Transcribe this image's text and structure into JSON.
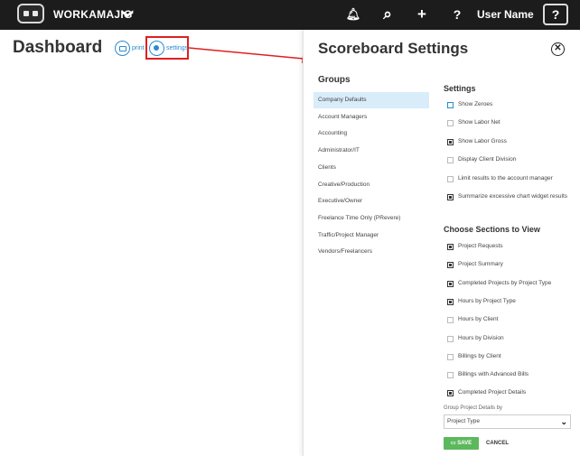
{
  "topbar": {
    "brand": "WORKAMAJIG",
    "brand_chevron": "❯",
    "icons": [
      "bell-icon",
      "search-icon",
      "plus-icon",
      "help-icon"
    ],
    "icon_glyphs": {
      "bell": "🔔︎",
      "search": "⌕",
      "plus": "+",
      "help": "?"
    },
    "username": "User Name",
    "help_box": "?"
  },
  "page": {
    "title": "Dashboard",
    "print_label": "print",
    "settings_label": "settings"
  },
  "panel": {
    "title": "Scoreboard Settings",
    "close_glyph": "✕",
    "groups_heading": "Groups",
    "groups": [
      {
        "label": "Company Defaults",
        "active": true
      },
      {
        "label": "Account Managers"
      },
      {
        "label": "Accounting"
      },
      {
        "label": "Administrator/IT"
      },
      {
        "label": "Clients"
      },
      {
        "label": "Creative/Production"
      },
      {
        "label": "Executive/Owner"
      },
      {
        "label": "Freelance Time Only (PRevere)"
      },
      {
        "label": "Traffic/Project Manager"
      },
      {
        "label": "Vendors/Freelancers"
      }
    ],
    "settings_heading": "Settings",
    "settings": [
      {
        "label": "Show Zeroes",
        "state": "blue"
      },
      {
        "label": "Show Labor Net",
        "state": "unchecked"
      },
      {
        "label": "Show Labor Gross",
        "state": "checked"
      },
      {
        "label": "Display Client Division",
        "state": "unchecked"
      },
      {
        "label": "Limit results to the account manager",
        "state": "unchecked"
      },
      {
        "label": "Summarize excessive chart widget results",
        "state": "checked"
      }
    ],
    "sections_heading": "Choose Sections to View",
    "sections": [
      {
        "label": "Project Requests",
        "state": "checked"
      },
      {
        "label": "Project Summary",
        "state": "checked"
      },
      {
        "label": "Completed Projects by Project Type",
        "state": "checked"
      },
      {
        "label": "Hours by Project Type",
        "state": "checked"
      },
      {
        "label": "Hours by Client",
        "state": "unchecked"
      },
      {
        "label": "Hours by Division",
        "state": "unchecked"
      },
      {
        "label": "Billings by Client",
        "state": "unchecked"
      },
      {
        "label": "Billings with Advanced Bills",
        "state": "unchecked"
      },
      {
        "label": "Completed Project Details",
        "state": "checked"
      }
    ],
    "group_details_label": "Group Project Details by",
    "group_details_value": "Project Type",
    "save_label": "SAVE",
    "cancel_label": "CANCEL"
  },
  "colors": {
    "topbar": "#1c1c1c",
    "link": "#2a8bd0",
    "highlight": "#e02020",
    "active_group": "#d9ecf9",
    "save": "#5cb85c"
  }
}
